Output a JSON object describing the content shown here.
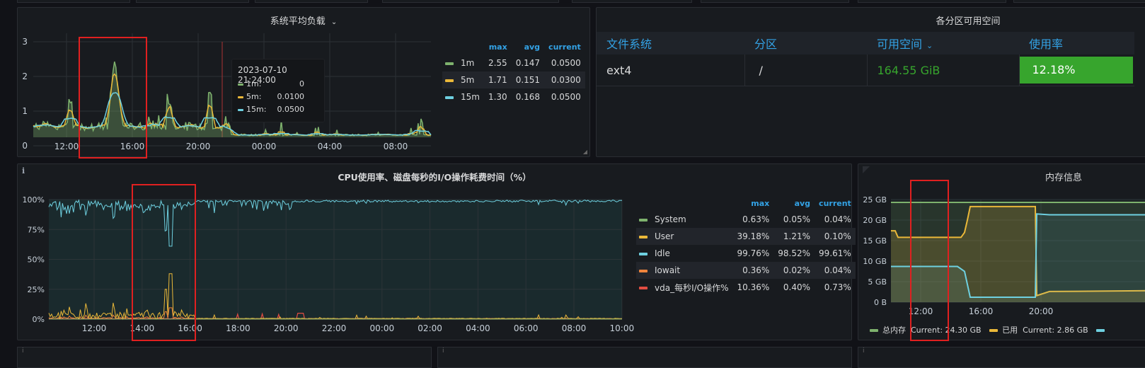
{
  "load_panel": {
    "title": "系统平均负载",
    "y_ticks": [
      "3",
      "2",
      "1",
      "0"
    ],
    "x_ticks": [
      "12:00",
      "16:00",
      "20:00",
      "00:00",
      "04:00",
      "08:00"
    ],
    "legend_headers": [
      "max",
      "avg",
      "current"
    ],
    "legend": [
      {
        "name": "1m",
        "max": "2.55",
        "avg": "0.147",
        "current": "0.0500",
        "color": "#7eb26d"
      },
      {
        "name": "5m",
        "max": "1.71",
        "avg": "0.151",
        "current": "0.0300",
        "color": "#eab839"
      },
      {
        "name": "15m",
        "max": "1.30",
        "avg": "0.168",
        "current": "0.0500",
        "color": "#6ed0e0"
      }
    ],
    "tooltip": {
      "time": "2023-07-10 21:24:00",
      "rows": [
        {
          "name": "1m:",
          "value": "0",
          "color": "#7eb26d"
        },
        {
          "name": "5m:",
          "value": "0.0100",
          "color": "#eab839"
        },
        {
          "name": "15m:",
          "value": "0.0500",
          "color": "#6ed0e0"
        }
      ]
    }
  },
  "fs_panel": {
    "title": "各分区可用空间",
    "headers": [
      "文件系统",
      "分区",
      "可用空间",
      "使用率"
    ],
    "rows": [
      {
        "fs": "ext4",
        "mount": "/",
        "free": "164.55 GiB",
        "usage": "12.18%"
      }
    ],
    "free_color": "#37a52d",
    "usage_bg": "#37a52d"
  },
  "cpu_panel": {
    "title": "CPU使用率、磁盘每秒的I/O操作耗费时间（%）",
    "info": "i",
    "y_ticks": [
      "100%",
      "75%",
      "50%",
      "25%",
      "0%"
    ],
    "x_ticks": [
      "12:00",
      "14:00",
      "16:00",
      "18:00",
      "20:00",
      "22:00",
      "00:00",
      "02:00",
      "04:00",
      "06:00",
      "08:00",
      "10:00"
    ],
    "legend_headers": [
      "max",
      "avg",
      "current"
    ],
    "legend": [
      {
        "name": "System",
        "max": "0.63%",
        "avg": "0.05%",
        "current": "0.04%",
        "color": "#7eb26d"
      },
      {
        "name": "User",
        "max": "39.18%",
        "avg": "1.21%",
        "current": "0.10%",
        "color": "#eab839"
      },
      {
        "name": "Idle",
        "max": "99.76%",
        "avg": "98.52%",
        "current": "99.61%",
        "color": "#6ed0e0"
      },
      {
        "name": "Iowait",
        "max": "0.36%",
        "avg": "0.02%",
        "current": "0.04%",
        "color": "#ef843c"
      },
      {
        "name": "vda_每秒I/O操作%",
        "max": "10.36%",
        "avg": "0.40%",
        "current": "0.73%",
        "color": "#e24d42"
      }
    ]
  },
  "mem_panel": {
    "title": "内存信息",
    "y_ticks": [
      "25 GB",
      "20 GB",
      "15 GB",
      "10 GB",
      "5 GB",
      "0 B"
    ],
    "x_ticks": [
      "12:00",
      "16:00",
      "20:00"
    ],
    "legend": [
      {
        "name": "总内存",
        "label": "Current: 24.30 GB",
        "color": "#7eb26d"
      },
      {
        "name": "已用",
        "label": "Current: 2.86 GB",
        "color": "#eab839"
      }
    ],
    "legend_trailing_color": "#6ed0e0"
  }
}
